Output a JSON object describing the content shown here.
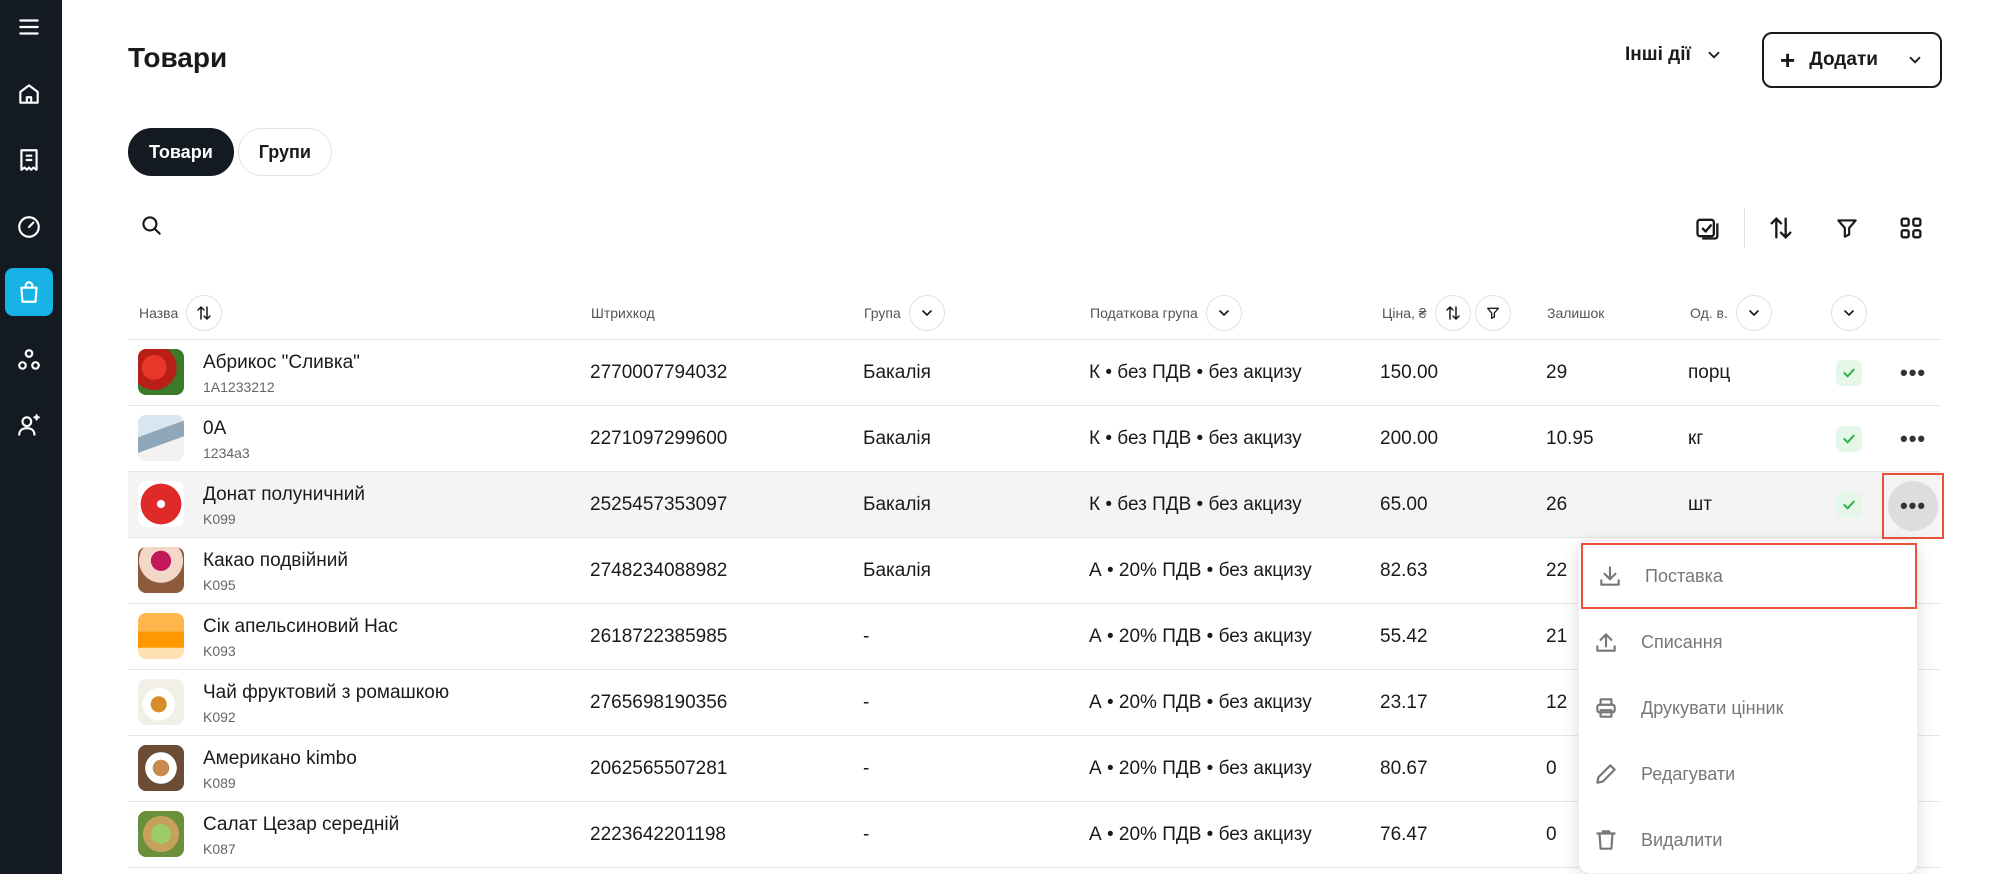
{
  "page": {
    "title": "Товари"
  },
  "header": {
    "other_actions": "Інші дії",
    "add_label": "Додати"
  },
  "tabs": [
    {
      "label": "Товари",
      "active": true
    },
    {
      "label": "Групи",
      "active": false
    }
  ],
  "sidebar": {
    "items": [
      {
        "icon": "menu-icon"
      },
      {
        "icon": "home-icon"
      },
      {
        "icon": "receipt-icon"
      },
      {
        "icon": "dashboard-icon"
      },
      {
        "icon": "bag-icon",
        "active": true
      },
      {
        "icon": "users-icon"
      },
      {
        "icon": "person-add-icon"
      }
    ],
    "active_color": "#17b3e6",
    "bg_color": "#141a21"
  },
  "table": {
    "columns": {
      "name": "Назва",
      "barcode": "Штрихкод",
      "group": "Група",
      "tax": "Податкова група",
      "price": "Ціна, ₴",
      "stock": "Залишок",
      "unit": "Од. в."
    },
    "rows": [
      {
        "name": "Абрикос \"Сливка\"",
        "code": "1А1233212",
        "barcode": "2770007794032",
        "group": "Бакалія",
        "tax": "К • без ПДВ • без акцизу",
        "price": "150.00",
        "stock": "29",
        "unit": "порц"
      },
      {
        "name": "0А",
        "code": "1234а3",
        "barcode": "2271097299600",
        "group": "Бакалія",
        "tax": "К • без ПДВ • без акцизу",
        "price": "200.00",
        "stock": "10.95",
        "unit": "кг"
      },
      {
        "name": "Донат полуничний",
        "code": "K099",
        "barcode": "2525457353097",
        "group": "Бакалія",
        "tax": "К • без ПДВ • без акцизу",
        "price": "65.00",
        "stock": "26",
        "unit": "шт"
      },
      {
        "name": "Какао подвійний",
        "code": "K095",
        "barcode": "2748234088982",
        "group": "Бакалія",
        "tax": "А • 20% ПДВ • без акцизу",
        "price": "82.63",
        "stock": "22",
        "unit": ""
      },
      {
        "name": "Сік апельсиновий Нас",
        "code": "K093",
        "barcode": "2618722385985",
        "group": "-",
        "tax": "А • 20% ПДВ • без акцизу",
        "price": "55.42",
        "stock": "21",
        "unit": ""
      },
      {
        "name": "Чай фруктовий з ромашкою",
        "code": "K092",
        "barcode": "2765698190356",
        "group": "-",
        "tax": "А • 20% ПДВ • без акцизу",
        "price": "23.17",
        "stock": "12",
        "unit": ""
      },
      {
        "name": "Американо kimbo",
        "code": "K089",
        "barcode": "2062565507281",
        "group": "-",
        "tax": "А • 20% ПДВ • без акцизу",
        "price": "80.67",
        "stock": "0",
        "unit": ""
      },
      {
        "name": "Салат Цезар середній",
        "code": "K087",
        "barcode": "2223642201198",
        "group": "-",
        "tax": "А • 20% ПДВ • без акцизу",
        "price": "76.47",
        "stock": "0",
        "unit": ""
      }
    ]
  },
  "menu": {
    "items": [
      {
        "label": "Поставка",
        "icon": "download-icon"
      },
      {
        "label": "Списання",
        "icon": "upload-icon"
      },
      {
        "label": "Друкувати цінник",
        "icon": "printer-icon"
      },
      {
        "label": "Редагувати",
        "icon": "pencil-icon"
      },
      {
        "label": "Видалити",
        "icon": "trash-icon"
      }
    ]
  },
  "colors": {
    "highlight_border": "#e8533a",
    "check_bg": "#e5f7e8",
    "check_mark": "#2db34a"
  }
}
